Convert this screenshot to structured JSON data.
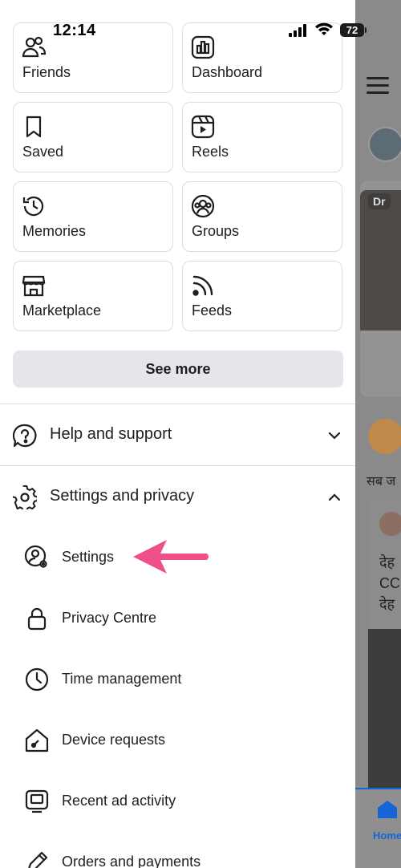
{
  "status_bar": {
    "time": "12:14",
    "battery": "72"
  },
  "shortcuts": [
    {
      "label": "Friends",
      "icon": "friends-icon"
    },
    {
      "label": "Dashboard",
      "icon": "dashboard-icon"
    },
    {
      "label": "Saved",
      "icon": "bookmark-icon"
    },
    {
      "label": "Reels",
      "icon": "reels-icon"
    },
    {
      "label": "Memories",
      "icon": "memories-icon"
    },
    {
      "label": "Groups",
      "icon": "groups-icon"
    },
    {
      "label": "Marketplace",
      "icon": "marketplace-icon"
    },
    {
      "label": "Feeds",
      "icon": "feeds-icon"
    }
  ],
  "see_more": "See more",
  "help": {
    "label": "Help and support",
    "icon": "help-icon",
    "expanded": false
  },
  "settings_privacy": {
    "label": "Settings and privacy",
    "icon": "gear-icon",
    "expanded": true,
    "items": [
      {
        "label": "Settings",
        "icon": "user-settings-icon"
      },
      {
        "label": "Privacy Centre",
        "icon": "lock-icon"
      },
      {
        "label": "Time management",
        "icon": "clock-icon"
      },
      {
        "label": "Device requests",
        "icon": "device-home-icon"
      },
      {
        "label": "Recent ad activity",
        "icon": "ad-activity-icon"
      },
      {
        "label": "Orders and payments",
        "icon": "pencil-icon"
      }
    ]
  },
  "background_feed": {
    "story_badge": "Dr",
    "post_text_snippet": "सब ज",
    "post_card_lines": [
      "देह",
      "CC",
      "देह"
    ],
    "bottom_nav_home": "Home"
  },
  "colors": {
    "accent": "#1565d8",
    "annotation_arrow": "#f0508a",
    "tile_border": "#dadde1",
    "button_bg": "#e4e6eb"
  }
}
